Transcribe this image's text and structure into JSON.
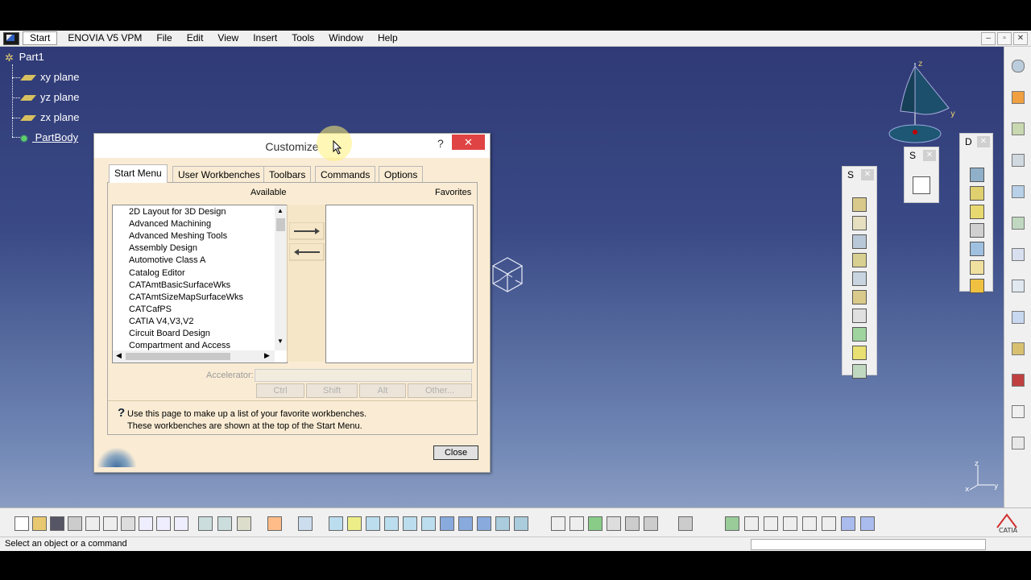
{
  "menu": {
    "start": "Start",
    "items": [
      "ENOVIA V5 VPM",
      "File",
      "Edit",
      "View",
      "Insert",
      "Tools",
      "Window",
      "Help"
    ]
  },
  "window_controls": [
    "–",
    "▫",
    "✕"
  ],
  "tree": {
    "root": "Part1",
    "items": [
      "xy plane",
      "yz plane",
      "zx plane",
      "PartBody"
    ]
  },
  "axis_labels": {
    "z": "z",
    "y": "y",
    "small_z": "z",
    "small_x": "x",
    "small_y": "y"
  },
  "dialog": {
    "title": "Customize",
    "help": "?",
    "tabs": [
      "Start Menu",
      "User Workbenches",
      "Toolbars",
      "Commands",
      "Options"
    ],
    "available_label": "Available",
    "favorites_label": "Favorites",
    "available_items": [
      "2D Layout for 3D Design",
      "Advanced Machining",
      "Advanced Meshing Tools",
      "Assembly Design",
      "Automotive Class A",
      "Catalog Editor",
      "CATAmtBasicSurfaceWks",
      "CATAmtSizeMapSurfaceWks",
      "CATCafPS",
      "CATIA V4,V3,V2",
      "Circuit Board Design",
      "Compartment and Access"
    ],
    "accelerator_label": "Accelerator:",
    "modifier_buttons": [
      "Ctrl",
      "Shift",
      "Alt",
      "Other..."
    ],
    "info_line1": "Use this page to make up a list of your favorite workbenches.",
    "info_line2": "These workbenches are shown at the top of the Start Menu.",
    "close_button": "Close"
  },
  "floating_toolbars": {
    "s1": "S",
    "s2": "S",
    "d": "D"
  },
  "status": {
    "text": "Select an object or a command"
  },
  "colors": {
    "viewport_top": "#2f3a76",
    "viewport_bottom": "#8a9cc2",
    "close_red": "#e04343"
  }
}
